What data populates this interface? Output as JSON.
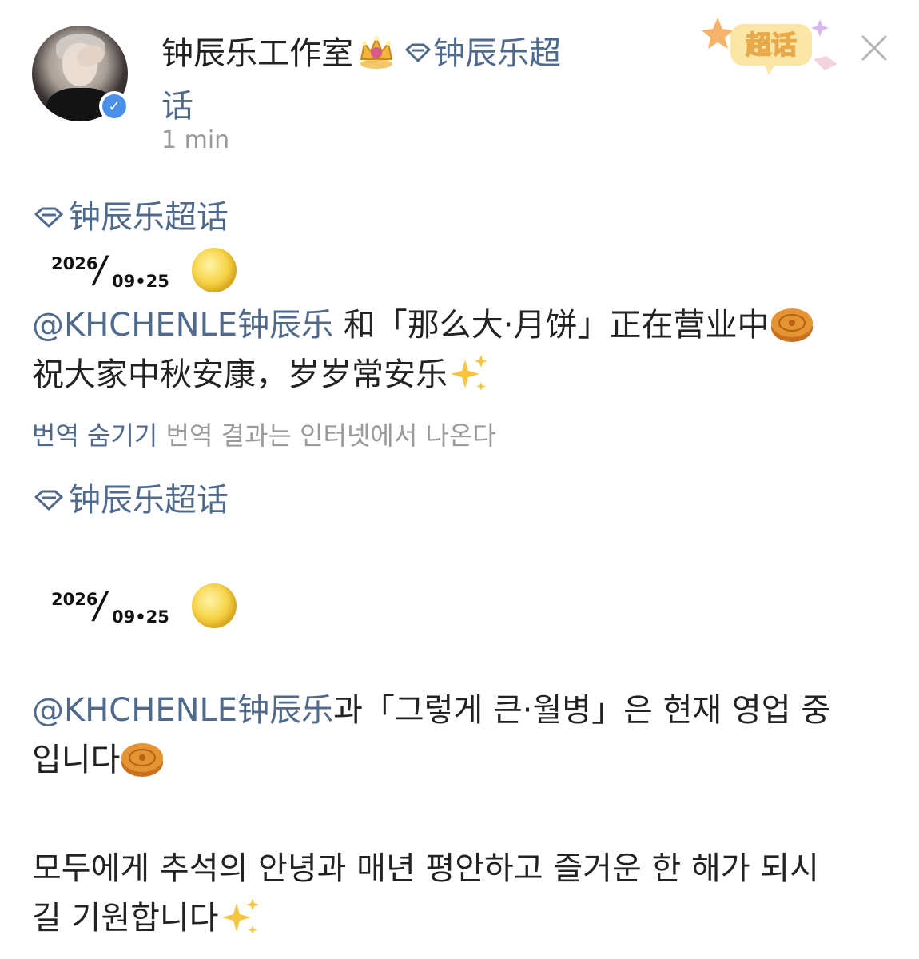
{
  "header": {
    "username": "钟辰乐工作室",
    "topic_prefix": "钟辰乐超",
    "topic_suffix": "话",
    "time": "1 min",
    "badge_label": "超话",
    "icons": [
      "crown-badge-icon",
      "diamond-topic-icon",
      "verified-v-icon",
      "close-icon"
    ]
  },
  "post": {
    "topic_1": "钟辰乐超话",
    "date_year": "2026",
    "date_md": "09•25",
    "cn_line_1_mention": "@KHCHENLE钟辰乐",
    "cn_line_1_text": " 和「那么大·月饼」正在营业中",
    "cn_line_2_text": "祝大家中秋安康，岁岁常安乐",
    "translate_link": "번역 숨기기",
    "translate_note": " 번역 결과는 인터넷에서 나온다",
    "topic_2": "钟辰乐超话",
    "date2_year": "2026",
    "date2_md": "09•25",
    "kr_line_1_mention": "@KHCHENLE钟辰乐",
    "kr_line_1_text": "과「그렇게 큰·월병」은 현재 영업 중",
    "kr_line_2_text": "입니다",
    "kr_line_3_text": "모두에게 추석의 안녕과 매년 평안하고 즐거운 한 해가 되시",
    "kr_line_4_text": "길 기원합니다"
  },
  "colors": {
    "link": "#4f6a8c",
    "muted": "#9a9a9a",
    "verified": "#4a8fe8"
  }
}
